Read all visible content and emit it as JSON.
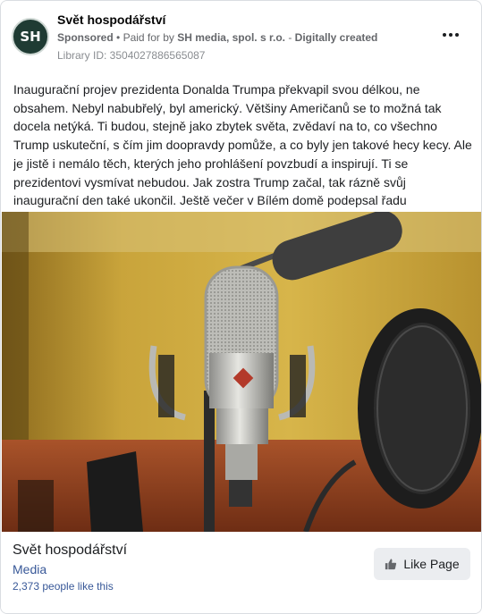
{
  "ad": {
    "page_name": "Svět hospodářství",
    "avatar_text": "SH",
    "sponsored": "Sponsored",
    "separator": "•",
    "paid_for_prefix": "Paid for by",
    "paid_by": "SH media, spol. s r.o.",
    "dash": "-",
    "digitally_created": "Digitally created",
    "library_id": "Library ID: 3504027886565087",
    "more_icon": "more-dots-icon",
    "body": "Inaugurační projev prezidenta Donalda Trumpa překvapil svou délkou, ne obsahem. Nebyl nabubřelý, byl americký. Většiny Američanů se to možná tak docela netýká. Ti budou, stejně jako zbytek světa, zvědaví na to, co všechno Trump uskuteční, s čím jim doopravdy pomůže, a co byly jen takové hecy kecy. Ale je jistě i nemálo těch, kterých jeho prohlášení povzbudí a inspirují. Ti se prezidentovi vysmívat nebudou. Jak zostra Trump začal, tak rázně svůj inaugurační den také ukončil. Ještě večer v Bílém domě podepsal řadu prezidentských dekretů. Podle prvních…"
  },
  "footer": {
    "page_name": "Svět hospodářství",
    "category": "Media",
    "likes": "2,373 people like this",
    "like_button": "Like Page",
    "like_icon": "thumbs-up-icon"
  },
  "colors": {
    "link": "#385898",
    "avatar_bg": "#1f3b33",
    "button_bg": "#ebedf0"
  }
}
